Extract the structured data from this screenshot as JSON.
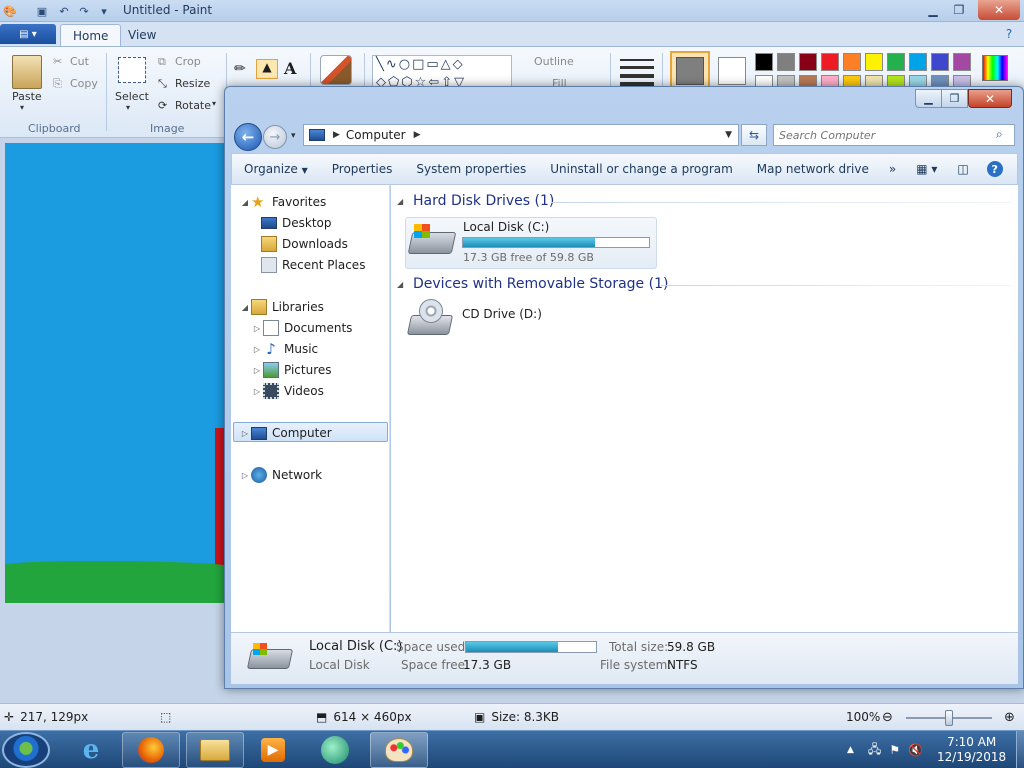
{
  "paint": {
    "title": "Untitled - Paint",
    "tabs": {
      "home": "Home",
      "view": "View"
    },
    "clipboard": {
      "paste": "Paste",
      "cut": "Cut",
      "copy": "Copy",
      "group": "Clipboard"
    },
    "image": {
      "select": "Select",
      "crop": "Crop",
      "resize": "Resize",
      "rotate": "Rotate",
      "group": "Image"
    },
    "shapes": {
      "outline": "Outline",
      "fill": "Fill"
    },
    "palette_row1": [
      "#000000",
      "#7f7f7f",
      "#880015",
      "#ed1c24",
      "#ff7f27",
      "#fff200",
      "#22b14c",
      "#00a2e8",
      "#3f48cc",
      "#a349a4"
    ],
    "palette_row2": [
      "#ffffff",
      "#c3c3c3",
      "#b97a57",
      "#ffaec9",
      "#ffc90e",
      "#efe4b0",
      "#b5e61d",
      "#99d9ea",
      "#7092be",
      "#c8bfe7"
    ],
    "status": {
      "cursor": "217, 129px",
      "size": "614 × 460px",
      "file_size": "Size: 8.3KB",
      "zoom": "100%"
    }
  },
  "explorer": {
    "address": "Computer",
    "search_placeholder": "Search Computer",
    "commands": {
      "organize": "Organize",
      "properties": "Properties",
      "system_properties": "System properties",
      "uninstall": "Uninstall or change a program",
      "map_drive": "Map network drive",
      "more": "»"
    },
    "nav": {
      "favorites": "Favorites",
      "desktop": "Desktop",
      "downloads": "Downloads",
      "recent": "Recent Places",
      "libraries": "Libraries",
      "documents": "Documents",
      "music": "Music",
      "pictures": "Pictures",
      "videos": "Videos",
      "computer": "Computer",
      "network": "Network"
    },
    "groups": {
      "hdd": "Hard Disk Drives (1)",
      "removable": "Devices with Removable Storage (1)"
    },
    "local_disk": {
      "name": "Local Disk (C:)",
      "free": "17.3 GB free of 59.8 GB",
      "used_fraction": 0.71
    },
    "cd_drive": {
      "name": "CD Drive (D:)"
    },
    "details": {
      "name": "Local Disk (C:)",
      "type": "Local Disk",
      "space_used_label": "Space used:",
      "space_free_label": "Space free:",
      "space_free": "17.3 GB",
      "total_size_label": "Total size:",
      "total_size": "59.8 GB",
      "fs_label": "File system:",
      "fs": "NTFS"
    }
  },
  "taskbar": {
    "time": "7:10 AM",
    "date": "12/19/2018"
  }
}
